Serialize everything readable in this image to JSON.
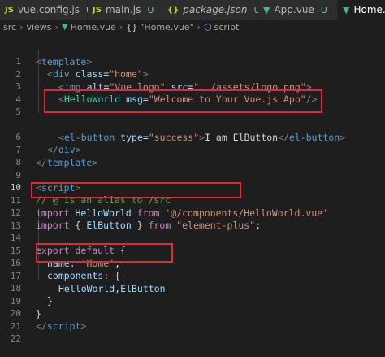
{
  "tabs": [
    {
      "icon": "JS",
      "label": "vue.config.js",
      "badge": "U",
      "italic": false,
      "active": false,
      "icon_kind": "js"
    },
    {
      "icon": "JS",
      "label": "main.js",
      "badge": "U",
      "italic": false,
      "active": false,
      "icon_kind": "js"
    },
    {
      "icon": "{}",
      "label": "package.json",
      "badge": "U",
      "italic": true,
      "active": false,
      "icon_kind": "json"
    },
    {
      "icon": "▼",
      "label": "App.vue",
      "badge": "U",
      "italic": false,
      "active": false,
      "icon_kind": "vue"
    },
    {
      "icon": "▼",
      "label": "Home.vue",
      "badge": "",
      "italic": false,
      "active": true,
      "icon_kind": "vue"
    }
  ],
  "breadcrumb": {
    "src": "src",
    "views": "views",
    "file": "Home.vue",
    "component": "\"Home.vue\"",
    "section": "script"
  },
  "line_numbers": [
    "1",
    "2",
    "3",
    "4",
    "5",
    "6",
    "7",
    "8",
    "9",
    "10",
    "11",
    "12",
    "13",
    "14",
    "15",
    "16",
    "17",
    "18",
    "19",
    "20",
    "21",
    "22"
  ],
  "code": {
    "l1": {
      "lt": "<",
      "tag": "template",
      "gt": ">"
    },
    "l2": {
      "lt": "<",
      "tag": "div",
      "attr": "class",
      "eq": "=",
      "val": "\"home\"",
      "gt": ">"
    },
    "l3": {
      "lt": "<",
      "tag": "img",
      "attr1": "alt",
      "eq": "=",
      "val1": "\"Vue logo\"",
      "attr2": "src",
      "val2": "\"../assets/logo.png\"",
      "gt": ">"
    },
    "l4": {
      "lt": "<",
      "tag": "HelloWorld",
      "attr": "msg",
      "eq": "=",
      "val": "\"Welcome to Your Vue.js App\"",
      "gt": "/>"
    },
    "l6": {
      "lt": "<",
      "tag": "el-button",
      "attr": "type",
      "eq": "=",
      "val": "\"success\"",
      "gt": ">",
      "text": "I am ElButton",
      "close_lt": "</",
      "close_tag": "el-button",
      "close_gt": ">"
    },
    "l7": {
      "lt": "</",
      "tag": "div",
      "gt": ">"
    },
    "l8": {
      "lt": "</",
      "tag": "template",
      "gt": ">"
    },
    "l10": {
      "lt": "<",
      "tag": "script",
      "gt": ">"
    },
    "l11": {
      "comment": "// @ is an alias to /src"
    },
    "l12": {
      "kw1": "import",
      "name": "HelloWorld",
      "kw2": "from",
      "str": "'@/components/HelloWorld.vue'"
    },
    "l13": {
      "kw1": "import",
      "open": "{",
      "name": "ElButton",
      "close": "}",
      "kw2": "from",
      "str": "\"element-plus\"",
      "semi": ";"
    },
    "l15": {
      "kw1": "export",
      "kw2": "default",
      "open": "{"
    },
    "l16": {
      "key": "name",
      "colon": ":",
      "str": "'Home'",
      "comma": ","
    },
    "l17": {
      "key": "components",
      "colon": ":",
      "open": "{"
    },
    "l18": {
      "text": "HelloWorld,ElButton"
    },
    "l19": {
      "close": "}"
    },
    "l20": {
      "close": "}"
    },
    "l21": {
      "lt": "</",
      "tag": "script",
      "gt": ">"
    }
  },
  "colors": {
    "highlight_box": "#e02b35",
    "vue_icon": "#41b883",
    "untracked_badge": "#73c991"
  }
}
